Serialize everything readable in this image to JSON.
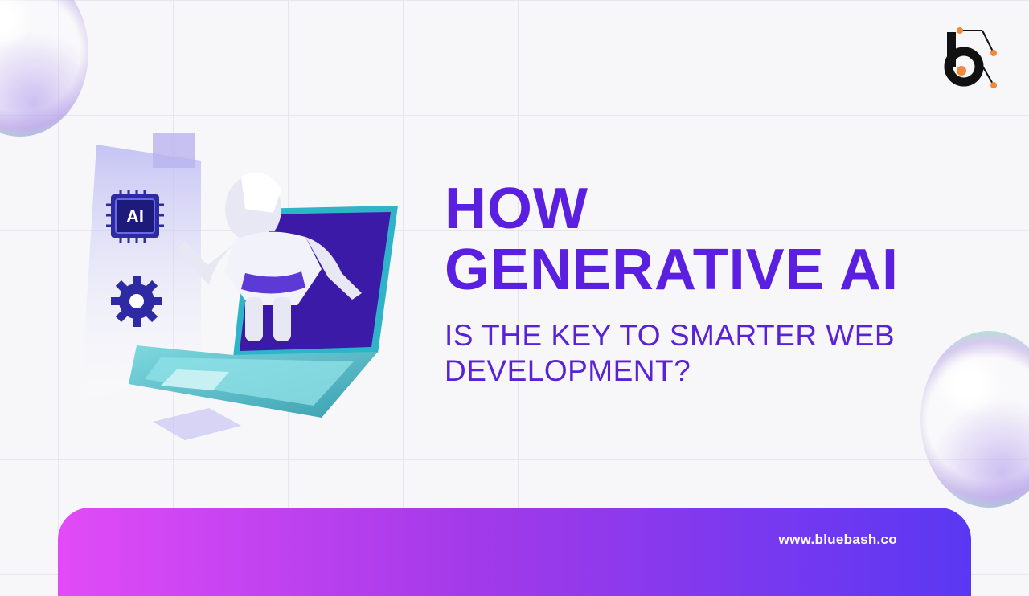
{
  "headline": {
    "line1": "HOW",
    "line2": "GENERATIVE AI",
    "line3": "IS THE KEY TO SMARTER WEB",
    "line4": "DEVELOPMENT?"
  },
  "illustration": {
    "chip_label": "AI"
  },
  "footer": {
    "url": "www.bluebash.co"
  },
  "colors": {
    "headline": "#5a1fe0",
    "footer_start": "#e14bf7",
    "footer_end": "#5a38f3",
    "logo_accent": "#f08a3a"
  }
}
